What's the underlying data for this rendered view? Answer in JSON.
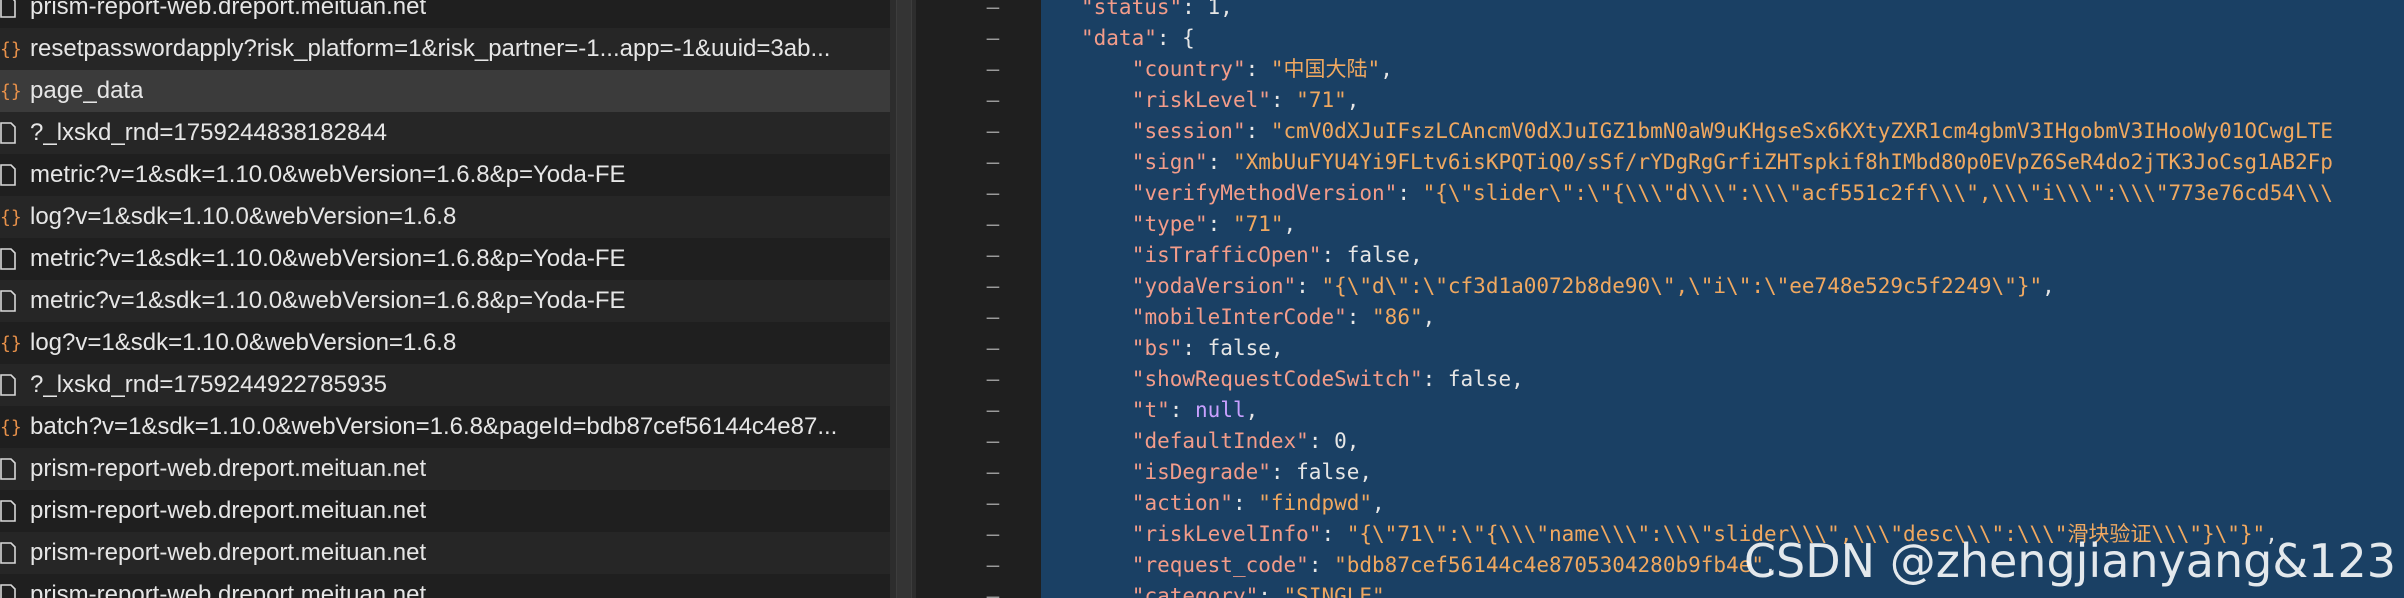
{
  "requests": [
    {
      "name": "prism-report-web.dreport.meituan.net",
      "icon": "document-icon"
    },
    {
      "name": "resetpasswordapply?risk_platform=1&risk_partner=-1...app=-1&uuid=3ab...",
      "icon": "xhr-icon"
    },
    {
      "name": "page_data",
      "icon": "xhr-icon",
      "selected": true
    },
    {
      "name": "?_lxskd_rnd=1759244838182844",
      "icon": "document-icon"
    },
    {
      "name": "metric?v=1&sdk=1.10.0&webVersion=1.6.8&p=Yoda-FE",
      "icon": "document-icon"
    },
    {
      "name": "log?v=1&sdk=1.10.0&webVersion=1.6.8",
      "icon": "xhr-icon"
    },
    {
      "name": "metric?v=1&sdk=1.10.0&webVersion=1.6.8&p=Yoda-FE",
      "icon": "document-icon"
    },
    {
      "name": "metric?v=1&sdk=1.10.0&webVersion=1.6.8&p=Yoda-FE",
      "icon": "document-icon"
    },
    {
      "name": "log?v=1&sdk=1.10.0&webVersion=1.6.8",
      "icon": "xhr-icon"
    },
    {
      "name": "?_lxskd_rnd=1759244922785935",
      "icon": "document-icon"
    },
    {
      "name": "batch?v=1&sdk=1.10.0&webVersion=1.6.8&pageId=bdb87cef56144c4e87...",
      "icon": "xhr-icon"
    },
    {
      "name": "prism-report-web.dreport.meituan.net",
      "icon": "document-icon"
    },
    {
      "name": "prism-report-web.dreport.meituan.net",
      "icon": "document-icon"
    },
    {
      "name": "prism-report-web.dreport.meituan.net",
      "icon": "document-icon"
    },
    {
      "name": "prism-report-web.dreport.meituan.net",
      "icon": "document-icon"
    }
  ],
  "code_lines": [
    {
      "gutter": "–",
      "indent": 4,
      "tokens": [
        [
          "k",
          "\"status\""
        ],
        [
          "p",
          ": 1,"
        ]
      ]
    },
    {
      "gutter": "–",
      "indent": 4,
      "tokens": [
        [
          "k",
          "\"data\""
        ],
        [
          "p",
          ": {"
        ]
      ]
    },
    {
      "gutter": "–",
      "indent": 8,
      "tokens": [
        [
          "k",
          "\"country\""
        ],
        [
          "p",
          ": "
        ],
        [
          "s",
          "\"中国大陆\""
        ],
        [
          "p",
          ","
        ]
      ]
    },
    {
      "gutter": "–",
      "indent": 8,
      "tokens": [
        [
          "k",
          "\"riskLevel\""
        ],
        [
          "p",
          ": "
        ],
        [
          "s",
          "\"71\""
        ],
        [
          "p",
          ","
        ]
      ]
    },
    {
      "gutter": "–",
      "indent": 8,
      "tokens": [
        [
          "k",
          "\"session\""
        ],
        [
          "p",
          ": "
        ],
        [
          "s",
          "\"cmV0dXJuIFszLCAncmV0dXJuIGZ1bmN0aW9uKHgseSx6KXtyZXR1cm4gbmV3IHgobmV3IHooWy01OCwgLTE"
        ]
      ]
    },
    {
      "gutter": "–",
      "indent": 8,
      "tokens": [
        [
          "k",
          "\"sign\""
        ],
        [
          "p",
          ": "
        ],
        [
          "s",
          "\"XmbUuFYU4Yi9FLtv6isKPQTiQ0/sSf/rYDgRgGrfiZHTspkif8hIMbd80p0EVpZ6SeR4do2jTK3JoCsg1AB2Fp"
        ]
      ]
    },
    {
      "gutter": "–",
      "indent": 8,
      "tokens": [
        [
          "k",
          "\"verifyMethodVersion\""
        ],
        [
          "p",
          ": "
        ],
        [
          "s",
          "\"{\\\"slider\\\":\\\"{\\\\\\\"d\\\\\\\":\\\\\\\"acf551c2ff\\\\\\\",\\\\\\\"i\\\\\\\":\\\\\\\"773e76cd54\\\\\\"
        ]
      ]
    },
    {
      "gutter": "–",
      "indent": 8,
      "tokens": [
        [
          "k",
          "\"type\""
        ],
        [
          "p",
          ": "
        ],
        [
          "s",
          "\"71\""
        ],
        [
          "p",
          ","
        ]
      ]
    },
    {
      "gutter": "–",
      "indent": 8,
      "tokens": [
        [
          "k",
          "\"isTrafficOpen\""
        ],
        [
          "p",
          ": false,"
        ]
      ]
    },
    {
      "gutter": "–",
      "indent": 8,
      "tokens": [
        [
          "k",
          "\"yodaVersion\""
        ],
        [
          "p",
          ": "
        ],
        [
          "s",
          "\"{\\\"d\\\":\\\"cf3d1a0072b8de90\\\",\\\"i\\\":\\\"ee748e529c5f2249\\\"}\""
        ],
        [
          "p",
          ","
        ]
      ]
    },
    {
      "gutter": "–",
      "indent": 8,
      "tokens": [
        [
          "k",
          "\"mobileInterCode\""
        ],
        [
          "p",
          ": "
        ],
        [
          "s",
          "\"86\""
        ],
        [
          "p",
          ","
        ]
      ]
    },
    {
      "gutter": "–",
      "indent": 8,
      "tokens": [
        [
          "k",
          "\"bs\""
        ],
        [
          "p",
          ": false,"
        ]
      ]
    },
    {
      "gutter": "–",
      "indent": 8,
      "tokens": [
        [
          "k",
          "\"showRequestCodeSwitch\""
        ],
        [
          "p",
          ": false,"
        ]
      ]
    },
    {
      "gutter": "–",
      "indent": 8,
      "tokens": [
        [
          "k",
          "\"t\""
        ],
        [
          "p",
          ": "
        ],
        [
          "n",
          "null"
        ],
        [
          "p",
          ","
        ]
      ]
    },
    {
      "gutter": "–",
      "indent": 8,
      "tokens": [
        [
          "k",
          "\"defaultIndex\""
        ],
        [
          "p",
          ": 0,"
        ]
      ]
    },
    {
      "gutter": "–",
      "indent": 8,
      "tokens": [
        [
          "k",
          "\"isDegrade\""
        ],
        [
          "p",
          ": false,"
        ]
      ]
    },
    {
      "gutter": "–",
      "indent": 8,
      "tokens": [
        [
          "k",
          "\"action\""
        ],
        [
          "p",
          ": "
        ],
        [
          "s",
          "\"findpwd\""
        ],
        [
          "p",
          ","
        ]
      ]
    },
    {
      "gutter": "–",
      "indent": 8,
      "tokens": [
        [
          "k",
          "\"riskLevelInfo\""
        ],
        [
          "p",
          ": "
        ],
        [
          "s",
          "\"{\\\"71\\\":\\\"{\\\\\\\"name\\\\\\\":\\\\\\\"slider\\\\\\\",\\\\\\\"desc\\\\\\\":\\\\\\\"滑块验证\\\\\\\"}\\\"}\""
        ],
        [
          "p",
          ","
        ]
      ]
    },
    {
      "gutter": "–",
      "indent": 8,
      "tokens": [
        [
          "k",
          "\"request_code\""
        ],
        [
          "p",
          ": "
        ],
        [
          "s",
          "\"bdb87cef56144c4e8705304280b9fb4e\""
        ],
        [
          "p",
          ","
        ]
      ]
    },
    {
      "gutter": "–",
      "indent": 8,
      "tokens": [
        [
          "k",
          "\"category\""
        ],
        [
          "p",
          ": "
        ],
        [
          "s",
          "\"SINGLE\""
        ],
        [
          "p",
          ","
        ]
      ]
    }
  ],
  "watermark": "CSDN @zhengjianyang&123",
  "colors": {
    "selection": "#1a4064",
    "key": "#f39c8a",
    "string": "#f0a860",
    "null": "#c9a0ff",
    "xhr_icon": "#e8914a"
  }
}
